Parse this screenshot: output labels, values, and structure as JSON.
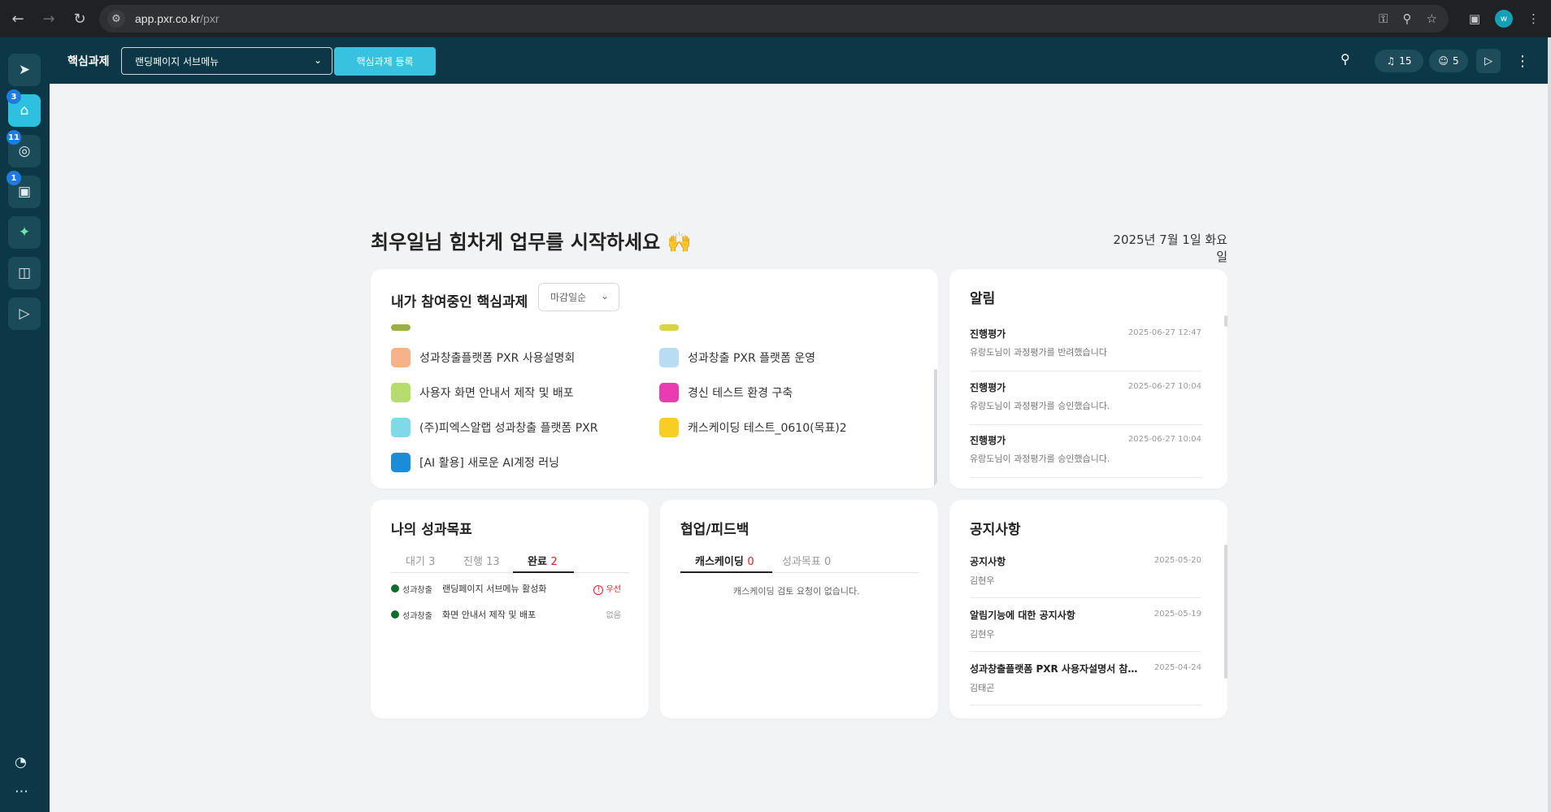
{
  "browser": {
    "url_host": "app.pxr.co.kr",
    "url_path": "/pxr",
    "profile_initial": "w"
  },
  "sidebar": {
    "badges": {
      "home": "3",
      "goals": "11",
      "schedule": "1"
    }
  },
  "topbar": {
    "title": "핵심과제",
    "select_value": "랜딩페이지 서브메뉴",
    "register_label": "핵심과제 등록",
    "notification_count": "15",
    "member_count": "5"
  },
  "welcome": {
    "greeting": "최우일님 힘차게 업무를 시작하세요",
    "date": "2025년 7월 1일 화요일"
  },
  "tasks_card": {
    "title": "내가 참여중인 핵심과제",
    "sort_value": "마감일순",
    "items": [
      {
        "label": "성과창출플랫폼 PXR 사용설명회",
        "color": "#f6b38b"
      },
      {
        "label": "성과창출 PXR 플랫폼 운영",
        "color": "#b7dcf3"
      },
      {
        "label": "사용자 화면 안내서 제작 및 배포",
        "color": "#b5dd6c"
      },
      {
        "label": "경신 테스트 환경 구축",
        "color": "#e83cb0"
      },
      {
        "label": "(주)피엑스알랩 성과창출 플랫폼 PXR",
        "color": "#7fd9e6"
      },
      {
        "label": "캐스케이딩 테스트_0610(목표)2",
        "color": "#f7cf24"
      },
      {
        "label": "[AI 활용] 새로운 AI계정 러닝",
        "color": "#1a8cd8"
      }
    ],
    "partial_colors": [
      "#9aae4a",
      "#d9d441"
    ]
  },
  "notifications": {
    "title": "알림",
    "items": [
      {
        "type": "진행평가",
        "date": "2025-06-27 12:47",
        "message": "유랑도님이 과정평가를 반려했습니다"
      },
      {
        "type": "진행평가",
        "date": "2025-06-27 10:04",
        "message": "유랑도님이 과정평가를 승인했습니다."
      },
      {
        "type": "진행평가",
        "date": "2025-06-27 10:04",
        "message": "유랑도님이 과정평가를 승인했습니다."
      }
    ]
  },
  "goals": {
    "title": "나의 성과목표",
    "tabs": [
      {
        "label": "대기",
        "count": "3"
      },
      {
        "label": "진행",
        "count": "13"
      },
      {
        "label": "완료",
        "count": "2"
      }
    ],
    "items": [
      {
        "category": "성과창출",
        "name": "랜딩페이지 서브메뉴 활성화",
        "status": "우선",
        "urgent_icon": "!"
      },
      {
        "category": "성과창출",
        "name": "화면 안내서 제작 및 배포",
        "status": "없음"
      }
    ]
  },
  "feedback": {
    "title": "협업/피드백",
    "tabs": [
      {
        "label": "캐스케이딩",
        "count": "0"
      },
      {
        "label": "성과목표",
        "count": "0"
      }
    ],
    "empty_message": "캐스케이딩 검토 요청이 없습니다."
  },
  "notices": {
    "title": "공지사항",
    "items": [
      {
        "title": "공지사항",
        "date": "2025-05-20",
        "author": "김현우"
      },
      {
        "title": "알림기능에 대한 공지사항",
        "date": "2025-05-19",
        "author": "김현우"
      },
      {
        "title": "성과창출플랫폼 PXR 사용자설명서 참조…",
        "date": "2025-04-24",
        "author": "김태곤"
      }
    ]
  },
  "colors": {
    "sidebar_bg": "#0b3746",
    "accent": "#39c2e0",
    "badge": "#1f7be0",
    "status_dot": "#0b6e2a",
    "urgent": "#e02020"
  }
}
